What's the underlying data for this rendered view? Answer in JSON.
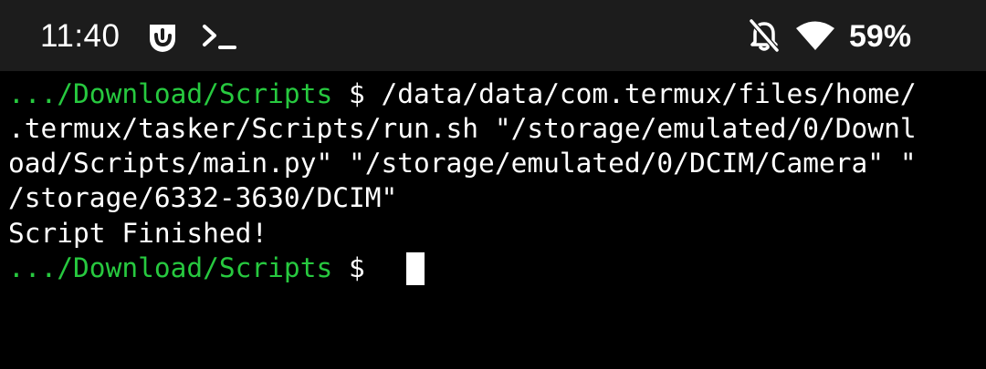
{
  "status_bar": {
    "time": "11:40",
    "icons_left": [
      "notification-app-icon",
      "terminal-prompt-icon"
    ],
    "icons_right": [
      "notifications-muted-icon",
      "wifi-icon"
    ],
    "battery_percent": "59%"
  },
  "terminal": {
    "lines": [
      {
        "prompt_path": ".../Download/Scripts",
        "prompt_symbol": " $ ",
        "text": "/data/data/com.termux/files/home/"
      },
      {
        "text": ".termux/tasker/Scripts/run.sh \"/storage/emulated/0/Downl"
      },
      {
        "text": "oad/Scripts/main.py\" \"/storage/emulated/0/DCIM/Camera\" \""
      },
      {
        "text": "/storage/6332-3630/DCIM\""
      },
      {
        "text": "Script Finished!"
      },
      {
        "prompt_path": ".../Download/Scripts",
        "prompt_symbol": " $ ",
        "text": ""
      }
    ]
  },
  "colors": {
    "status_bar_bg": "#1c1c1c",
    "terminal_bg": "#000000",
    "prompt_path": "#27c93f",
    "text": "#ffffff"
  }
}
